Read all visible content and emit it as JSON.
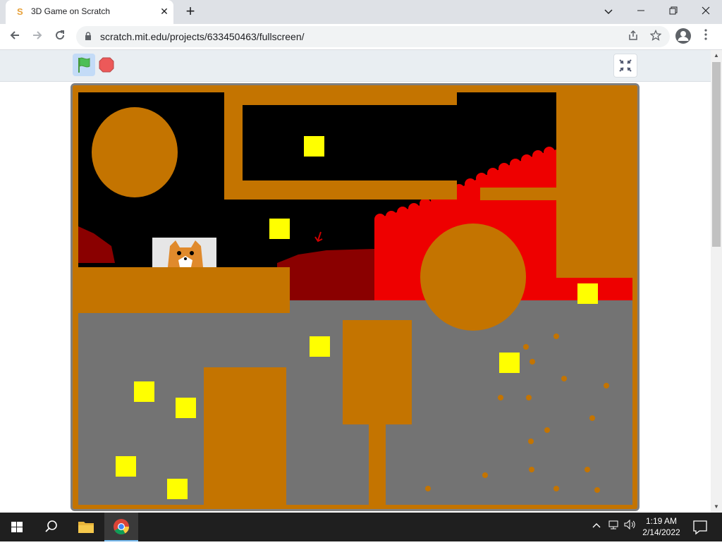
{
  "browser": {
    "tab_title": "3D Game on Scratch",
    "tab_close": "✕",
    "new_tab": "+",
    "url": "scratch.mit.edu/projects/633450463/fullscreen/",
    "window_minimize": "—",
    "window_restore": "❐",
    "window_close": "✕",
    "collapse_tabs": "⌄"
  },
  "scratch": {
    "green_flag_color": "#4cbf56",
    "stop_color": "#ec5959"
  },
  "game": {
    "colors": {
      "wall": "#c47400",
      "sky": "#000000",
      "floor": "#737373",
      "lava": "#ee0000",
      "coin": "#ffff00"
    }
  },
  "taskbar": {
    "time": "1:19 AM",
    "date": "2/14/2022"
  }
}
